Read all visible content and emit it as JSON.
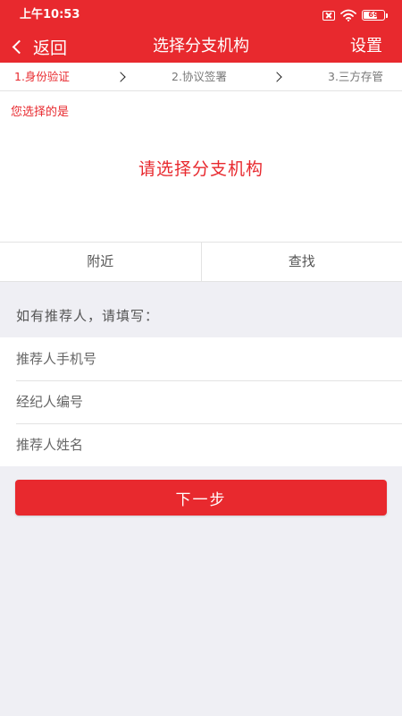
{
  "status_bar": {
    "time": "上午10:53",
    "battery_level": "69",
    "battery_fraction": 0.69,
    "icons": [
      "sim-off-icon",
      "wifi-icon",
      "battery-icon"
    ]
  },
  "nav": {
    "back_label": "返回",
    "title": "选择分支机构",
    "settings_label": "设置"
  },
  "steps": [
    {
      "label": "1.身份验证",
      "active": true
    },
    {
      "label": "2.协议签署",
      "active": false
    },
    {
      "label": "3.三方存管",
      "active": false
    }
  ],
  "selection": {
    "label": "您选择的是",
    "prompt": "请选择分支机构"
  },
  "tabs": [
    {
      "label": "附近"
    },
    {
      "label": "查找"
    }
  ],
  "referrer": {
    "hint": "如有推荐人，请填写：",
    "fields": [
      {
        "placeholder": "推荐人手机号",
        "value": ""
      },
      {
        "placeholder": "经纪人编号",
        "value": ""
      },
      {
        "placeholder": "推荐人姓名",
        "value": ""
      }
    ]
  },
  "next_button": {
    "label": "下一步"
  },
  "colors": {
    "brand_red": "#e8292e",
    "background": "#efeff4"
  }
}
